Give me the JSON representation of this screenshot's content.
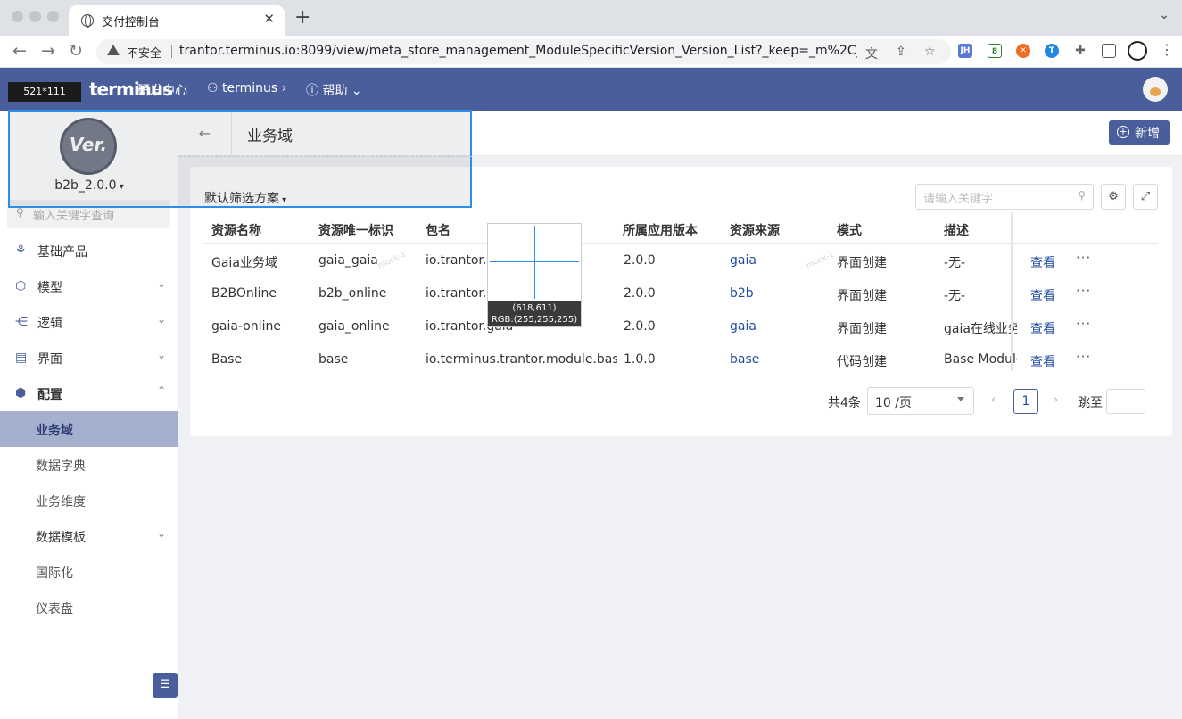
{
  "browser": {
    "tab_title": "交付控制台",
    "security_label": "不安全",
    "url": "trantor.terminus.io:8099/view/meta_store_management_ModuleSpecificVersion_Version_List?_keep=_m%2C_tena...",
    "ext_jh": "JH"
  },
  "app": {
    "logo": "terminus",
    "nav": {
      "dev_center": "研发中心",
      "user": "terminus",
      "help": "帮助"
    }
  },
  "overlay": {
    "selection_size": "521*111",
    "magnifier_coords": "(618,611)",
    "magnifier_rgb": "RGB:(255,255,255)"
  },
  "sidebar": {
    "logo_text": "Ver.",
    "version": "b2b_2.0.0",
    "search_placeholder": "输入关键字查询",
    "menu": {
      "base_product": "基础产品",
      "model": "模型",
      "logic": "逻辑",
      "ui": "界面",
      "config": "配置"
    },
    "config_children": {
      "business_domain": "业务域",
      "data_dict": "数据字典",
      "business_dimension": "业务维度",
      "data_template": "数据模板",
      "i18n": "国际化",
      "dashboard": "仪表盘"
    }
  },
  "page": {
    "title": "业务域",
    "add_label": "新增",
    "filter_scheme": "默认筛选方案",
    "search_placeholder": "请输入关键字"
  },
  "table": {
    "columns": {
      "name": "资源名称",
      "key": "资源唯一标识",
      "package": "包名",
      "app_version": "所属应用版本",
      "source": "资源来源",
      "mode": "模式",
      "desc": "描述"
    },
    "rows": [
      {
        "name": "Gaia业务域",
        "key": "gaia_gaia",
        "package": "io.trantor.g",
        "version": "2.0.0",
        "source": "gaia",
        "mode": "界面创建",
        "desc": "-无-",
        "view": "查看",
        "more": "···"
      },
      {
        "name": "B2BOnline",
        "key": "b2b_online",
        "package": "io.trantor.b",
        "version": "2.0.0",
        "source": "b2b",
        "mode": "界面创建",
        "desc": "-无-",
        "view": "查看",
        "more": "···"
      },
      {
        "name": "gaia-online",
        "key": "gaia_online",
        "package": "io.trantor.gaia",
        "version": "2.0.0",
        "source": "gaia",
        "mode": "界面创建",
        "desc": "gaia在线业务",
        "view": "查看",
        "more": "···"
      },
      {
        "name": "Base",
        "key": "base",
        "package": "io.terminus.trantor.module.base",
        "version": "1.0.0",
        "source": "base",
        "mode": "代码创建",
        "desc": "Base Module",
        "view": "查看",
        "more": "···"
      }
    ]
  },
  "pagination": {
    "total": "共4条",
    "page_size": "10 /页",
    "current": "1",
    "jump_label": "跳至"
  },
  "watermark_text": "mock-1"
}
